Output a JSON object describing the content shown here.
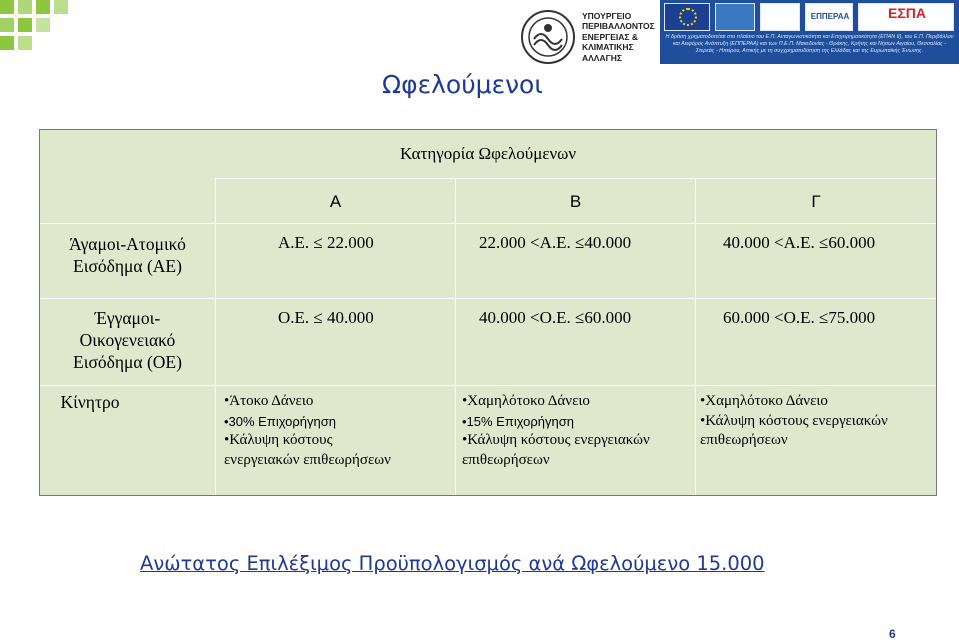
{
  "header": {
    "ministry_lines": [
      "ΥΠΟΥΡΓΕΙΟ",
      "ΠΕΡΙΒΑΛΛΟΝΤΟΣ",
      "ΕΝΕΡΓΕΙΑΣ &",
      "ΚΛΙΜΑΤΙΚΗΣ",
      "ΑΛΛΑΓΗΣ"
    ],
    "epperaa_label": "ΕΠΠΕΡΑΑ",
    "espa_label": "ΕΣΠΑ",
    "banner_note": "Η δράση χρηματοδοτείται στο πλαίσιο του Ε.Π. Ανταγωνιστικότητα και Επιχειρηματικότητα (ΕΠΑΝ ΙΙ), του Ε.Π. Περιβάλλον και Αειφόρος Ανάπτυξη (ΕΠΠΕΡΑΑ) και των Π.Ε.Π. Μακεδονίας - Θράκης, Κρήτης και Νήσων Αιγαίου, Θεσσαλίας - Στερεάς - Ηπείρου, Αττικής με τη συγχρηματοδότηση της Ελλάδας και της Ευρωπαϊκής Ένωσης."
  },
  "title": "Ωφελούμενοι",
  "table": {
    "category_header": "Κατηγορία Ωφελούμενων",
    "columns": [
      "Α",
      "Β",
      "Γ"
    ],
    "rows": [
      {
        "label_lines": [
          "Άγαμοι-Ατομικό",
          "Εισόδημα (ΑΕ)"
        ],
        "cells": [
          "Α.Ε. ≤ 22.000",
          "22.000 <Α.Ε. ≤40.000",
          "40.000 <Α.Ε. ≤60.000"
        ]
      },
      {
        "label_lines": [
          "Έγγαμοι-",
          "Οικογενειακό",
          "Εισόδημα (ΟΕ)"
        ],
        "cells": [
          "Ο.Ε. ≤ 40.000",
          "40.000 <Ο.Ε. ≤60.000",
          "60.000 <Ο.Ε. ≤75.000"
        ]
      }
    ],
    "incentive_label": "Κίνητρο",
    "incentives": [
      [
        "•Άτοκο Δάνειο",
        "•30% Επιχορήγηση",
        "•Κάλυψη κόστους",
        "ενεργειακών επιθεωρήσεων"
      ],
      [
        "•Χαμηλότοκο Δάνειο",
        "•15% Επιχορήγηση",
        "•Κάλυψη κόστους ενεργειακών",
        "επιθεωρήσεων"
      ],
      [
        "•Χαμηλότοκο Δάνειο",
        "•Κάλυψη κόστους ενεργειακών",
        "επιθεωρήσεων"
      ]
    ]
  },
  "budget_text": "Ανώτατος Επιλέξιμος Προϋπολογισμός ανά Ωφελούμενο 15.000",
  "page_number": "6"
}
